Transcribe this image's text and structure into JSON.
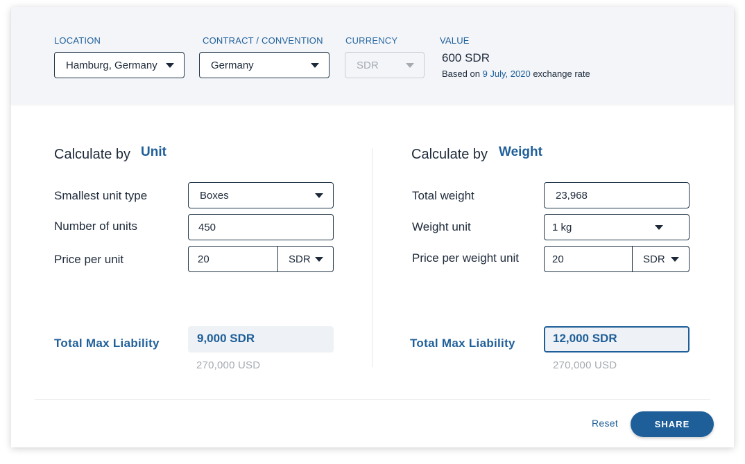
{
  "header": {
    "location": {
      "label": "LOCATION",
      "value": "Hamburg, Germany"
    },
    "contract": {
      "label": "CONTRACT / CONVENTION",
      "value": "Germany"
    },
    "currency": {
      "label": "CURRENCY",
      "value": "SDR"
    },
    "value": {
      "label": "VALUE",
      "amount": "600 SDR",
      "note_prefix": "Based on",
      "note_date": "9 July, 2020",
      "note_suffix": "exchange rate"
    }
  },
  "unit_calc": {
    "title": "Calculate by",
    "accent": "Unit",
    "smallest_unit_label": "Smallest unit type",
    "smallest_unit_value": "Boxes",
    "number_units_label": "Number of units",
    "number_units_value": "450",
    "price_label": "Price per unit",
    "price_value": "20",
    "price_currency": "SDR",
    "total_label": "Total Max Liability",
    "total_value": "9,000 SDR",
    "total_usd": "270,000  USD"
  },
  "weight_calc": {
    "title": "Calculate by",
    "accent": "Weight",
    "total_weight_label": "Total weight",
    "total_weight_value": "23,968",
    "weight_unit_label": "Weight unit",
    "weight_unit_value": "1 kg",
    "price_label": "Price per weight unit",
    "price_value": "20",
    "price_currency": "SDR",
    "total_label": "Total Max Liability",
    "total_value": "12,000 SDR",
    "total_usd": "270,000  USD"
  },
  "footer": {
    "reset_label": "Reset",
    "share_label": "SHARE"
  },
  "colors": {
    "accent": "#1f5f99",
    "header_bg": "#f3f5f9",
    "text": "#1d2939",
    "muted": "#a6abb2"
  }
}
